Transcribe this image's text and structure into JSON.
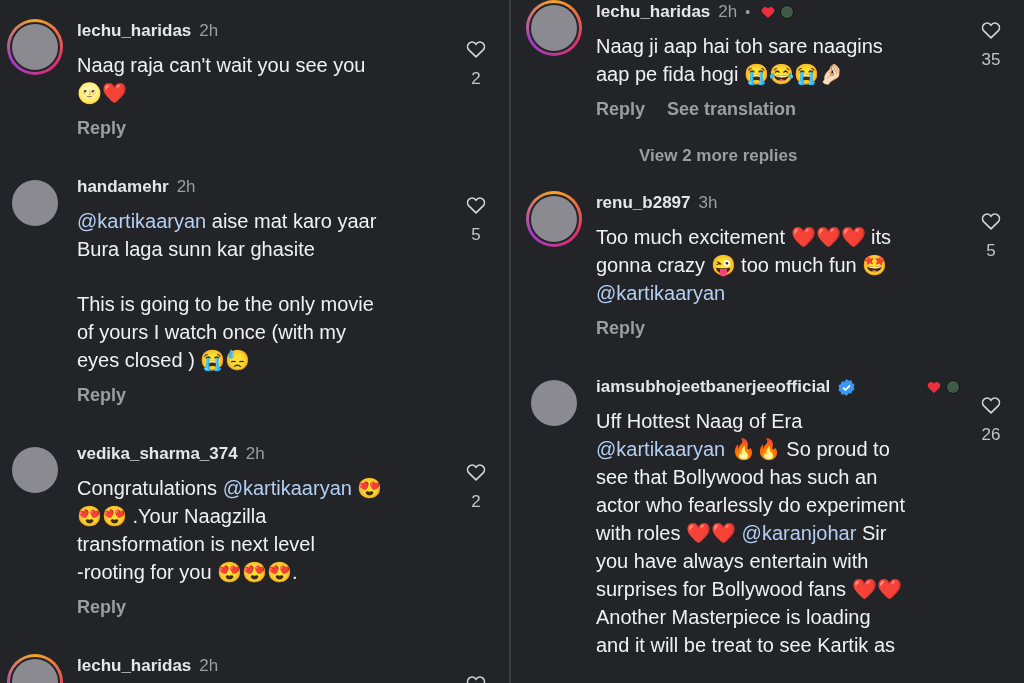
{
  "panels": [
    {
      "comments": [
        {
          "kind": "comment",
          "username": "lechu_haridas",
          "time": "2h",
          "story_ring": true,
          "likes": "2",
          "paragraphs": [
            [
              [
                {
                  "kind": "text",
                  "text": "Naag raja can't wait you see you"
                }
              ],
              [
                {
                  "kind": "text",
                  "text": "🌝❤️"
                }
              ]
            ]
          ],
          "actions": [
            "Reply"
          ]
        },
        {
          "kind": "comment",
          "username": "handamehr",
          "time": "2h",
          "story_ring": false,
          "likes": "5",
          "paragraphs": [
            [
              [
                {
                  "kind": "mention",
                  "text": "@kartikaaryan"
                },
                {
                  "kind": "text",
                  "text": " aise mat karo yaar"
                }
              ],
              [
                {
                  "kind": "text",
                  "text": "Bura laga sunn kar ghasite"
                }
              ]
            ],
            [
              [
                {
                  "kind": "text",
                  "text": "This is going to be the only movie"
                }
              ],
              [
                {
                  "kind": "text",
                  "text": "of yours I watch once (with my"
                }
              ],
              [
                {
                  "kind": "text",
                  "text": "eyes closed ) 😭😓"
                }
              ]
            ]
          ],
          "actions": [
            "Reply"
          ]
        },
        {
          "kind": "comment",
          "username": "vedika_sharma_374",
          "time": "2h",
          "story_ring": false,
          "likes": "2",
          "paragraphs": [
            [
              [
                {
                  "kind": "text",
                  "text": "Congratulations "
                },
                {
                  "kind": "mention",
                  "text": "@kartikaaryan"
                },
                {
                  "kind": "text",
                  "text": " 😍"
                }
              ],
              [
                {
                  "kind": "text",
                  "text": "😍😍 .Your  Naagzilla"
                }
              ],
              [
                {
                  "kind": "text",
                  "text": "transformation is next level"
                }
              ],
              [
                {
                  "kind": "text",
                  "text": "-rooting for you 😍😍😍."
                }
              ]
            ]
          ],
          "actions": [
            "Reply"
          ]
        },
        {
          "kind": "comment",
          "username": "lechu_haridas",
          "time": "2h",
          "story_ring": true
        }
      ]
    },
    {
      "comments": [
        {
          "kind": "comment",
          "username": "lechu_haridas",
          "time": "2h",
          "dot": "•",
          "liked_by_author": true,
          "story_ring": true,
          "likes": "35",
          "paragraphs": [
            [
              [
                {
                  "kind": "text",
                  "text": "Naag ji aap hai toh sare naagins"
                }
              ],
              [
                {
                  "kind": "text",
                  "text": "aap pe fida hogi 😭😂😭🤌🏻"
                }
              ]
            ]
          ],
          "actions": [
            "Reply",
            "See translation"
          ]
        },
        {
          "kind": "view_replies",
          "text": "View 2 more replies"
        },
        {
          "kind": "comment",
          "username": "renu_b2897",
          "time": "3h",
          "story_ring": true,
          "likes": "5",
          "paragraphs": [
            [
              [
                {
                  "kind": "text",
                  "text": "Too much excitement ❤️❤️❤️ its"
                }
              ],
              [
                {
                  "kind": "text",
                  "text": "gonna crazy 😜 too much fun 🤩"
                }
              ],
              [
                {
                  "kind": "mention",
                  "text": "@kartikaaryan"
                }
              ]
            ]
          ],
          "actions": [
            "Reply"
          ]
        },
        {
          "kind": "comment",
          "username": "iamsubhojeetbanerjeeofficial",
          "verified": true,
          "liked_by_author": true,
          "story_ring": false,
          "likes": "26",
          "paragraphs": [
            [
              [
                {
                  "kind": "text",
                  "text": "Uff Hottest Naag of Era"
                }
              ],
              [
                {
                  "kind": "mention",
                  "text": "@kartikaaryan"
                },
                {
                  "kind": "text",
                  "text": " 🔥🔥 So proud to"
                }
              ],
              [
                {
                  "kind": "text",
                  "text": "see that Bollywood has such an"
                }
              ],
              [
                {
                  "kind": "text",
                  "text": "actor who fearlessly do experiment"
                }
              ],
              [
                {
                  "kind": "text",
                  "text": "with roles ❤️❤️ "
                },
                {
                  "kind": "mention",
                  "text": "@karanjohar"
                },
                {
                  "kind": "text",
                  "text": " Sir"
                }
              ],
              [
                {
                  "kind": "text",
                  "text": "you have always entertain with"
                }
              ],
              [
                {
                  "kind": "text",
                  "text": "surprises for Bollywood fans ❤️❤️"
                }
              ],
              [
                {
                  "kind": "text",
                  "text": "Another Masterpiece is loading"
                }
              ],
              [
                {
                  "kind": "text",
                  "text": "and it will be treat to see Kartik as"
                }
              ]
            ]
          ]
        }
      ]
    }
  ]
}
